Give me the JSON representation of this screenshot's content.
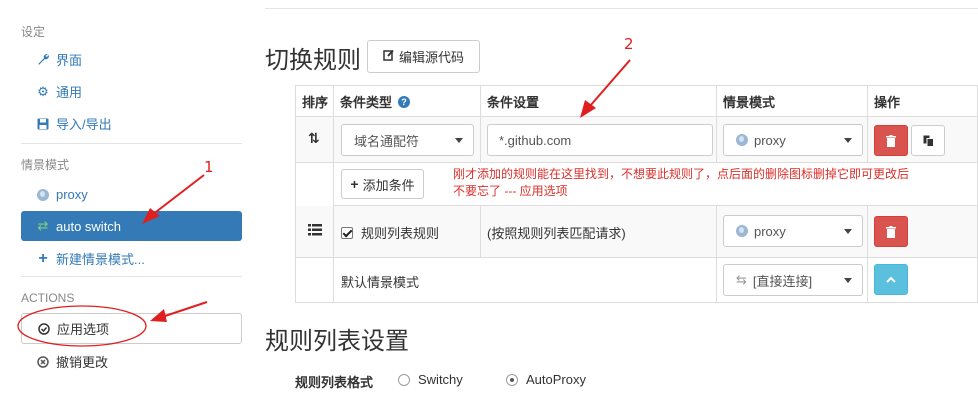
{
  "sidebar": {
    "settings_label": "设定",
    "settings_items": [
      {
        "label": "界面",
        "icon": "wrench-icon"
      },
      {
        "label": "通用",
        "icon": "gear-icon"
      },
      {
        "label": "导入/导出",
        "icon": "floppy-icon"
      }
    ],
    "profiles_label": "情景模式",
    "profiles": [
      {
        "label": "proxy",
        "icon": "globe-icon"
      },
      {
        "label": "auto switch",
        "icon": "switch-icon",
        "active": true
      },
      {
        "label": "新建情景模式...",
        "icon": "plus-icon"
      }
    ],
    "actions_label": "ACTIONS",
    "actions": [
      {
        "label": "应用选项",
        "icon": "check-circle-icon"
      },
      {
        "label": "撤销更改",
        "icon": "x-circle-icon"
      }
    ]
  },
  "main": {
    "switch_rules_title": "切换规则",
    "edit_source_label": "编辑源代码",
    "table": {
      "headers": [
        "排序",
        "条件类型",
        "条件设置",
        "情景模式",
        "操作"
      ],
      "rows": [
        {
          "condition_type": "域名通配符",
          "condition_value": "*.github.com",
          "profile": "proxy"
        }
      ],
      "add_condition_label": "添加条件",
      "annotation": "刚才添加的规则能在这里找到，不想要此规则了，点后面的删除图标删掉它即可更改后不要忘了 --- 应用选项",
      "rule_list_row": {
        "label": "规则列表规则",
        "checked": true,
        "setting": "(按照规则列表匹配请求)",
        "profile": "proxy"
      },
      "default_row": {
        "label": "默认情景模式",
        "profile": "[直接连接]"
      }
    },
    "rule_list_title": "规则列表设置",
    "rule_list_format_label": "规则列表格式",
    "formats": [
      {
        "label": "Switchy",
        "selected": false
      },
      {
        "label": "AutoProxy",
        "selected": true
      }
    ]
  },
  "annotations": {
    "marker_1": "1",
    "marker_2": "2",
    "color": "#e02020"
  },
  "colors": {
    "primary": "#337ab7",
    "danger": "#d9534f",
    "info": "#5bc0de"
  }
}
